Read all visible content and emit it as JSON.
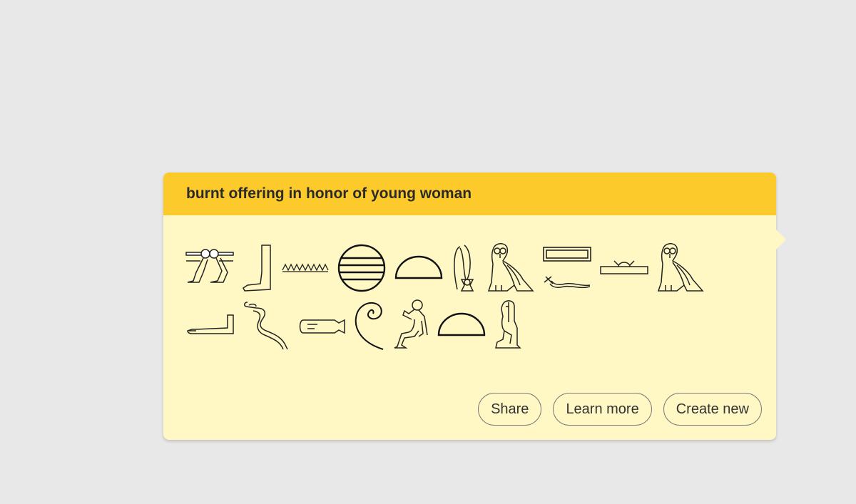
{
  "card": {
    "title": "burnt offering in honor of young woman",
    "header_color": "#fdca2b",
    "body_color": "#fff8c5"
  },
  "glyph_rows": [
    [
      "pool-with-legs-glyph",
      "leg-glyph",
      "water-ripple-glyph",
      "placenta-disk-glyph",
      "bread-loaf-glyph",
      "flax-wick-glyph",
      "owl-glyph",
      "door-bolt-glyph",
      "horned-viper-glyph",
      "sunrise-glyph",
      "owl-glyph"
    ],
    [
      "arm-glyph",
      "cobra-glyph",
      "vase-glyph",
      "coil-glyph",
      "seated-man-hand-to-mouth-glyph",
      "bread-loaf-glyph",
      "seated-woman-glyph"
    ]
  ],
  "actions": {
    "share_label": "Share",
    "learn_more_label": "Learn more",
    "create_new_label": "Create new"
  }
}
